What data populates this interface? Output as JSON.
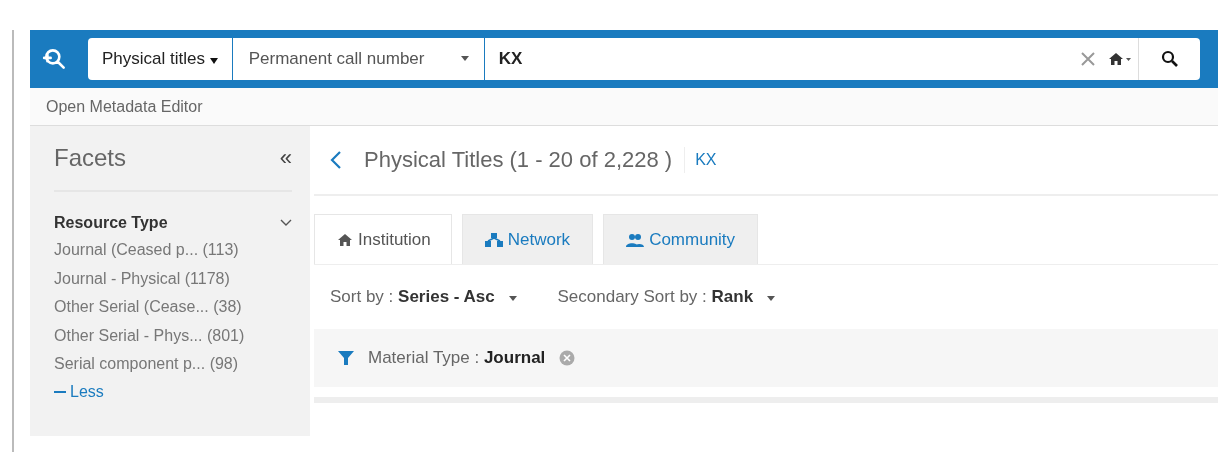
{
  "search_bar": {
    "scope": "Physical titles",
    "field": "Permanent call number",
    "query": "KX"
  },
  "toolbar": {
    "link": "Open Metadata Editor"
  },
  "facets": {
    "title": "Facets",
    "collapse": "«",
    "groups": [
      {
        "title": "Resource Type",
        "expanded": true,
        "items": [
          {
            "label": "Journal (Ceased p...",
            "count": "(113)"
          },
          {
            "label": "Journal - Physical",
            "count": "(1178)"
          },
          {
            "label": "Other Serial (Cease...",
            "count": "(38)"
          },
          {
            "label": "Other Serial - Phys...",
            "count": "(801)"
          },
          {
            "label": "Serial component p...",
            "count": "(98)"
          }
        ],
        "toggle": "Less"
      }
    ]
  },
  "results": {
    "title": "Physical Titles (1 - 20 of 2,228 )",
    "query": "KX",
    "tabs": [
      {
        "label": "Institution",
        "kind": "home",
        "selected": true
      },
      {
        "label": "Network",
        "kind": "network",
        "selected": false
      },
      {
        "label": "Community",
        "kind": "community",
        "selected": false
      }
    ],
    "sort": {
      "label": "Sort by :",
      "value": "Series - Asc"
    },
    "secondary_sort": {
      "label": "Secondary Sort by :",
      "value": "Rank"
    },
    "filter": {
      "label": "Material Type :",
      "value": "Journal"
    }
  }
}
